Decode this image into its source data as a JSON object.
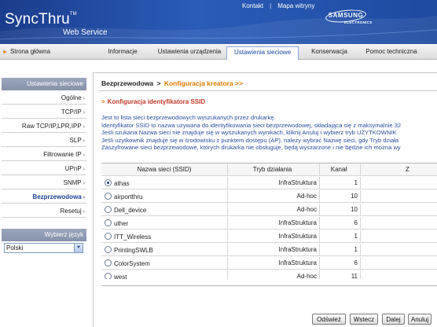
{
  "header": {
    "brand_name": "SyncThru",
    "brand_tm": "TM",
    "brand_sub": "Web Service",
    "links": [
      "Kontakt",
      "Mapa witryny"
    ],
    "link_separator": "|",
    "logo_word": "SAMSUNG",
    "logo_sub": "ELECTRONICS"
  },
  "nav": {
    "home_label": "Strona główna",
    "tabs": [
      {
        "label": "Informacje"
      },
      {
        "label": "Ustawienia urządzenia"
      },
      {
        "label": "Ustawienia sieciowe"
      },
      {
        "label": "Konserwacja"
      },
      {
        "label": "Pomoc techniczna"
      }
    ],
    "active_tab": "Ustawienia sieciowe"
  },
  "sidebar": {
    "heading": "Ustawienia sieciowe",
    "items": [
      {
        "label": "Ogólne"
      },
      {
        "label": "TCP/IP"
      },
      {
        "label": "Raw TCP/IP,LPR,IPP"
      },
      {
        "label": "SLP"
      },
      {
        "label": "Filtrowanie IP"
      },
      {
        "label": "UPnP"
      },
      {
        "label": "SNMP"
      },
      {
        "label": "Bezprzewodowa"
      },
      {
        "label": "Resetuj"
      }
    ],
    "active_item": "Bezprzewodowa",
    "arrow_glyph": "›"
  },
  "language": {
    "heading": "Wybierz język",
    "selected": "Polski"
  },
  "main": {
    "breadcrumb": {
      "first": "Bezprzewodowa",
      "sep": ">",
      "second": "Konfiguracja kreatora >>"
    },
    "section_title": "Konfiguracja identyfikatora SSID",
    "description": [
      "Jest to lista sieci bezprzewodowych wyszukanych przez drukarkę.",
      "Identyfikator SSID to nazwa używana do identyfikowania sieci bezprzewodowej, składająca się z maksymalnie 32",
      "Jeśli szukana Nazwa sieci nie znajduje się w wyszukanych wynikach, kliknij Anuluj i wybierz tryb UŻYTKOWNIK",
      "Jeśli użytkownik znajduje się w środowisku z punktem dostępu (AP), należy wybrać Nazwę sieci, gdy Tryb działa",
      "Zaszyfrowane sieci bezprzewodowe, których drukarka nie obsługuje, będą wyszarzone i nie będzie ich można wy"
    ],
    "table": {
      "headers": {
        "ssid": "Nazwa sieci (SSID)",
        "mode": "Tryb działania",
        "channel": "Kanał",
        "more": "Z"
      },
      "rows": [
        {
          "ssid": "athas",
          "mode": "InfraStruktura",
          "channel": "1",
          "selected": true
        },
        {
          "ssid": "airportthru",
          "mode": "Ad-hoc",
          "channel": "10",
          "selected": false
        },
        {
          "ssid": "Dell_device",
          "mode": "Ad-hoc",
          "channel": "10",
          "selected": false
        },
        {
          "ssid": "uther",
          "mode": "InfraStruktura",
          "channel": "6",
          "selected": false
        },
        {
          "ssid": "ITT_Wireless",
          "mode": "InfraStruktura",
          "channel": "1",
          "selected": false
        },
        {
          "ssid": "PrintingSWLB",
          "mode": "InfraStruktura",
          "channel": "1",
          "selected": false
        },
        {
          "ssid": "ColorSystem",
          "mode": "InfraStruktura",
          "channel": "6",
          "selected": false
        },
        {
          "ssid": "west",
          "mode": "Ad-hoc",
          "channel": "11",
          "selected": false
        }
      ]
    },
    "buttons": {
      "refresh": "Odśwież",
      "back": "Wstecz",
      "next": "Dalej",
      "cancel": "Anuluj"
    }
  },
  "colors": {
    "header_blue": "#2b5cb8",
    "accent_orange": "#e07a00",
    "title_red": "#c0392b",
    "desc_blue": "#2b4fa0",
    "sidebar_head": "#8793ab"
  }
}
